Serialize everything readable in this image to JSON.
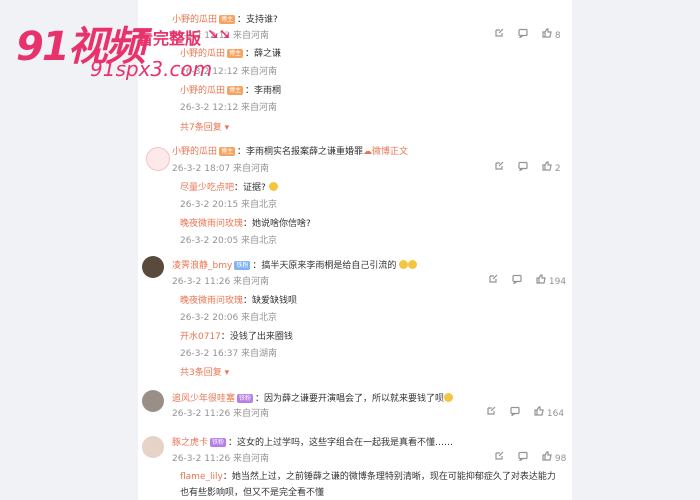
{
  "watermark": {
    "brand": "91视频",
    "tag": "看完整版",
    "url": "91spx3.com"
  },
  "thread1": {
    "user": "小野的瓜田",
    "badge": "博主",
    "text": "：支持谁?",
    "likes": "8",
    "replies": [
      {
        "user": "小野的瓜田",
        "badge": "博主",
        "text": "：薛之谦",
        "meta": "26-3-2 12:12 来自河南"
      },
      {
        "user": "小野的瓜田",
        "badge": "博主",
        "text": "：李雨桐",
        "meta": "26-3-2 12:12 来自河南"
      }
    ],
    "first_meta": "26-3-2 12:12 来自河南",
    "more": "共7条回复"
  },
  "thread2": {
    "user": "小野的瓜田",
    "badge": "博主",
    "text": "：李雨桐实名报案薛之谦重婚罪",
    "link": "微博正文",
    "meta": "26-3-2 18:07 来自河南",
    "likes": "2",
    "replies": [
      {
        "user": "尽量少吃点吧",
        "text": "：证据?",
        "meta": "26-3-2 20:15 来自北京"
      },
      {
        "user": "晚夜微雨问玫瑰",
        "text": "：她说啥你信啥?",
        "meta": "26-3-2 20:05 来自北京"
      }
    ]
  },
  "thread3": {
    "user": "凌霁浪静_bmy",
    "badge": "铁粉",
    "text": "：搞半天原来李雨桐是给自己引流的",
    "meta": "26-3-2 11:26 来自河南",
    "likes": "194",
    "replies": [
      {
        "user": "晚夜微雨问玫瑰",
        "text": "：缺爱缺钱呗",
        "meta": "26-3-2 20:06 来自北京"
      },
      {
        "user": "开水0717",
        "text": "：没钱了出来圈钱",
        "meta": "26-3-2 16:37 来自湖南"
      }
    ],
    "more": "共3条回复"
  },
  "thread4": {
    "user": "追风少年很哇塞",
    "badge": "铁粉",
    "text": "：因为薛之谦要开演唱会了，所以就来要钱了呗",
    "meta": "26-3-2 11:26 来自河南",
    "likes": "164"
  },
  "thread5": {
    "user": "豚之虎卡",
    "badge": "铁粉",
    "text": "：这女的上过学吗，这些字组合在一起我是真看不懂……",
    "meta": "26-3-2 11:26 来自河南",
    "likes": "98",
    "reply": {
      "user": "flame_lily",
      "text": "：她当然上过，之前锤薛之谦的微博条理特别清晰，现在可能抑郁症久了对表达能力",
      "text2": "也有些影响呗，但又不是完全看不懂"
    }
  },
  "colors": {
    "accent": "#eb7350",
    "meta": "#939393",
    "watermark": "#e8326c"
  },
  "icons": [
    "share-icon",
    "comment-icon",
    "like-icon"
  ]
}
